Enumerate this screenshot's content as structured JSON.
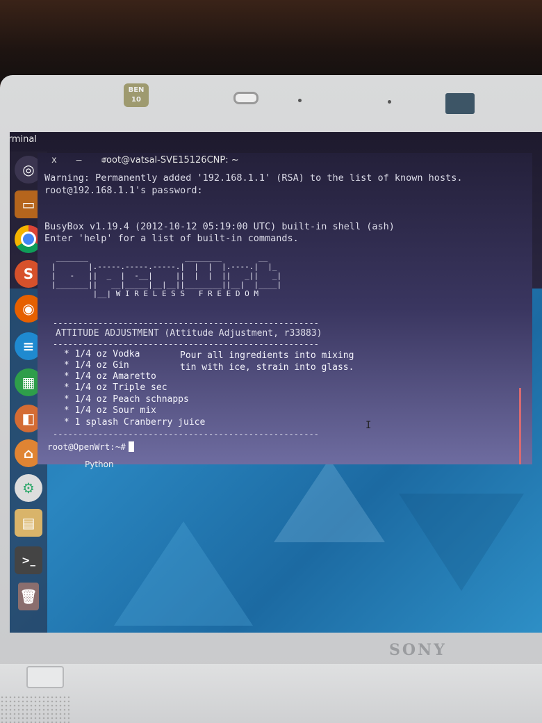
{
  "panel": {
    "app_title": "Terminal"
  },
  "hardware": {
    "brand": "SONY",
    "sticker": "BEN 10"
  },
  "window": {
    "title": "root@vatsal-SVE15126CNP: ~",
    "controls": "x – ▫"
  },
  "terminal": {
    "lines": [
      "Warning: Permanently added '192.168.1.1' (RSA) to the list of known hosts.",
      "root@192.168.1.1's password:",
      "BusyBox v1.19.4 (2012-10-12 05:19:00 UTC) built-in shell (ash)",
      "Enter 'help' for a list of built-in commands."
    ],
    "ascii_logo": " _______                     ________        __\n|       |.-----.-----.-----.|  |  |  |.----.|  |_\n|   -   ||  _  |  -__|     ||  |  |  ||   _||   _|\n|_______||   __|_____|__|__||________||__|  |____|\n         |__| W I R E L E S S   F R E E D O M",
    "tagline": "W I R E L E S S   F R E E D O M",
    "separator": "-----------------------------------------------------",
    "release": "ATTITUDE ADJUSTMENT (Attitude Adjustment, r33883)",
    "recipe": [
      " * 1/4 oz Vodka",
      " * 1/4 oz Gin",
      " * 1/4 oz Amaretto",
      " * 1/4 oz Triple sec",
      " * 1/4 oz Peach schnapps",
      " * 1/4 oz Sour mix",
      " * 1 splash Cranberry juice"
    ],
    "instructions": [
      "Pour all ingredients into mixing",
      "tin with ice, strain into glass."
    ],
    "prompt": "root@OpenWrt:~#"
  },
  "tooltip": "Python",
  "launcher": {
    "items": [
      {
        "icon": "ubuntu-dash-icon",
        "color": "#e95420"
      },
      {
        "icon": "files-icon",
        "color": "#b5651d"
      },
      {
        "icon": "chrome-icon",
        "color": "#db4437"
      },
      {
        "icon": "sublime-icon",
        "color": "#d7512b"
      },
      {
        "icon": "firefox-icon",
        "color": "#e66000"
      },
      {
        "icon": "writer-icon",
        "color": "#1f8ad0"
      },
      {
        "icon": "calc-icon",
        "color": "#2e9e4a"
      },
      {
        "icon": "impress-icon",
        "color": "#d46c34"
      },
      {
        "icon": "software-center-icon",
        "color": "#e08433"
      },
      {
        "icon": "settings-icon",
        "color": "#2ea86a"
      },
      {
        "icon": "notes-icon",
        "color": "#d9b46a"
      },
      {
        "icon": "terminal-icon",
        "color": "#444"
      },
      {
        "icon": "trash-icon",
        "color": "#8a6e6e"
      }
    ]
  }
}
